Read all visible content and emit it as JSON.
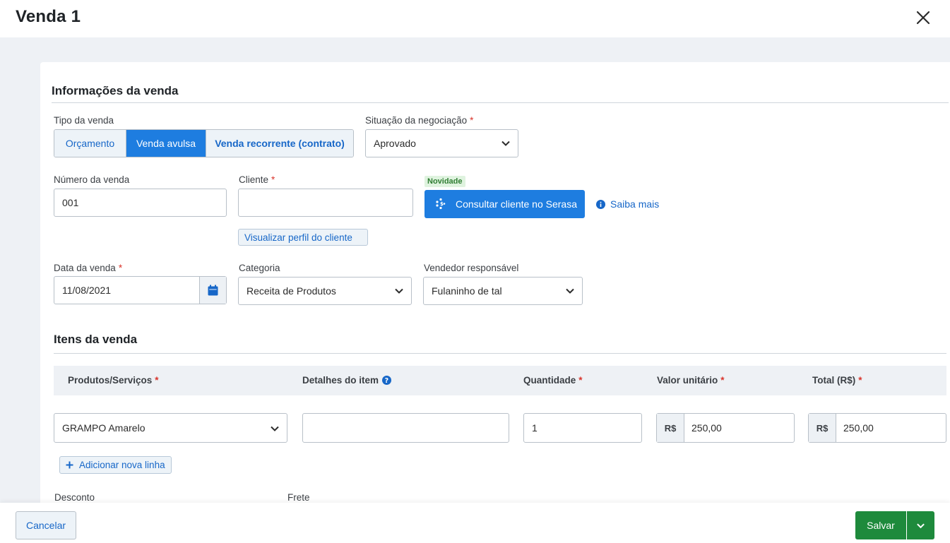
{
  "header": {
    "title": "Venda 1"
  },
  "sale_info": {
    "section_title": "Informações da venda",
    "type_label": "Tipo da venda",
    "type_options": [
      "Orçamento",
      "Venda avulsa",
      "Venda recorrente (contrato)"
    ],
    "type_selected": "Venda avulsa",
    "status_label": "Situação da negociação",
    "status_value": "Aprovado",
    "number_label": "Número da venda",
    "number_value": "001",
    "client_label": "Cliente",
    "client_value": "",
    "view_client_label": "Visualizar perfil do cliente",
    "badge_new": "Novidade",
    "serasa_button": "Consultar cliente no Serasa",
    "learn_more": "Saiba mais",
    "date_label": "Data da venda",
    "date_value": "11/08/2021",
    "category_label": "Categoria",
    "category_value": "Receita de Produtos",
    "seller_label": "Vendedor responsável",
    "seller_value": "Fulaninho de tal",
    "required_mark": "*"
  },
  "items": {
    "section_title": "Itens da venda",
    "columns": [
      "Produtos/Serviços",
      "Detalhes do item",
      "Quantidade",
      "Valor unitário",
      "Total (R$)"
    ],
    "rows": [
      {
        "product": "GRAMPO Amarelo",
        "details": "",
        "quantity": "1",
        "currency": "R$",
        "unit_value": "250,00",
        "total": "250,00"
      }
    ],
    "add_row_label": "Adicionar nova linha"
  },
  "extras": {
    "discount_label": "Desconto",
    "shipping_label": "Frete"
  },
  "footer": {
    "cancel_label": "Cancelar",
    "save_label": "Salvar"
  },
  "colors": {
    "primary": "#1e7de0",
    "success": "#1e8a3c",
    "required": "#d9342b"
  }
}
